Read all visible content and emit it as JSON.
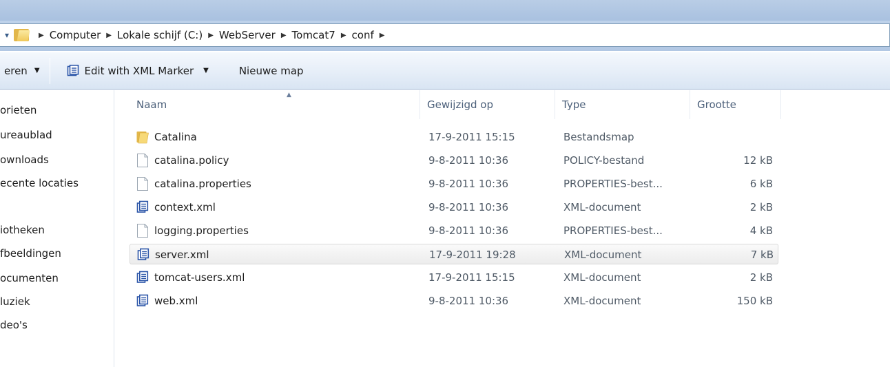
{
  "address": {
    "crumbs": [
      "Computer",
      "Lokale schijf (C:)",
      "WebServer",
      "Tomcat7",
      "conf"
    ]
  },
  "toolbar": {
    "organize_label": "eren",
    "xml_marker_label": "Edit with XML Marker",
    "new_folder_label": "Nieuwe map"
  },
  "navpane": {
    "items": [
      "orieten",
      "ureaublad",
      "ownloads",
      "ecente locaties",
      "iotheken",
      "fbeeldingen",
      "ocumenten",
      "luziek",
      "deo's"
    ]
  },
  "columns": {
    "name": "Naam",
    "modified": "Gewijzigd op",
    "type": "Type",
    "size": "Grootte"
  },
  "files": [
    {
      "name": "Catalina",
      "modified": "17-9-2011 15:15",
      "type": "Bestandsmap",
      "size": "",
      "icon": "folder-icon"
    },
    {
      "name": "catalina.policy",
      "modified": "9-8-2011 10:36",
      "type": "POLICY-bestand",
      "size": "12 kB",
      "icon": "file-icon"
    },
    {
      "name": "catalina.properties",
      "modified": "9-8-2011 10:36",
      "type": "PROPERTIES-best...",
      "size": "6 kB",
      "icon": "file-icon"
    },
    {
      "name": "context.xml",
      "modified": "9-8-2011 10:36",
      "type": "XML-document",
      "size": "2 kB",
      "icon": "xml-file-icon"
    },
    {
      "name": "logging.properties",
      "modified": "9-8-2011 10:36",
      "type": "PROPERTIES-best...",
      "size": "4 kB",
      "icon": "file-icon"
    },
    {
      "name": "server.xml",
      "modified": "17-9-2011 19:28",
      "type": "XML-document",
      "size": "7 kB",
      "icon": "xml-file-icon"
    },
    {
      "name": "tomcat-users.xml",
      "modified": "17-9-2011 15:15",
      "type": "XML-document",
      "size": "2 kB",
      "icon": "xml-file-icon"
    },
    {
      "name": "web.xml",
      "modified": "9-8-2011 10:36",
      "type": "XML-document",
      "size": "150 kB",
      "icon": "xml-file-icon"
    }
  ],
  "selected_file": "server.xml",
  "colors": {
    "accent": "#3a5d8a",
    "folder": "#e2b74a",
    "xml_icon": "#2b55a8"
  }
}
